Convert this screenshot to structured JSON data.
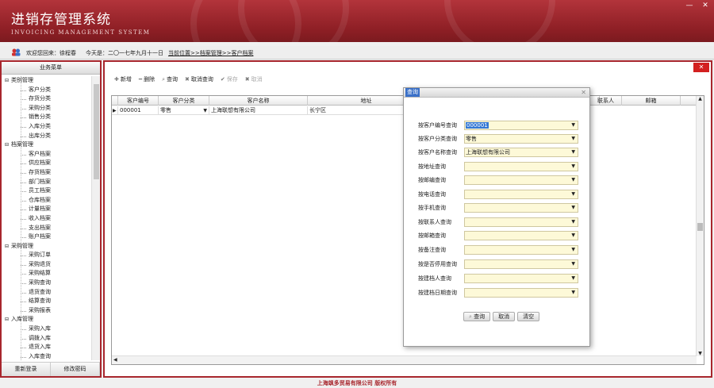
{
  "app": {
    "title": "进销存管理系统",
    "subtitle": "INVOICING MANAGEMENT SYSTEM"
  },
  "window_controls": {
    "minimize": "—",
    "close": "✕"
  },
  "infobar": {
    "welcome": "欢迎您回来：徐程春",
    "date": "今天是：二〇一七年九月十一日",
    "location": "当前位置>>档案管理>>客户档案"
  },
  "sidebar": {
    "header": "业务菜单",
    "groups": [
      {
        "label": "类别管理",
        "items": [
          "客户分类",
          "存货分类",
          "采购分类",
          "销售分类",
          "入库分类",
          "出库分类"
        ]
      },
      {
        "label": "档案管理",
        "items": [
          "客户档案",
          "供应档案",
          "存货档案",
          "部门档案",
          "员工档案",
          "仓库档案",
          "计量档案",
          "收入档案",
          "支出档案",
          "账户档案"
        ]
      },
      {
        "label": "采购管理",
        "items": [
          "采购订单",
          "采购退货",
          "采购结算",
          "采购查询",
          "退货查询",
          "结算查询",
          "采购报表"
        ]
      },
      {
        "label": "入库管理",
        "items": [
          "采购入库",
          "调拨入库",
          "退货入库",
          "入库查询"
        ]
      }
    ],
    "footer": {
      "relogin": "重新登录",
      "change_password": "修改密码"
    }
  },
  "toolbar": {
    "add": "新增",
    "delete": "删除",
    "query": "查询",
    "cancel_query": "取消查询",
    "save": "保存",
    "cancel": "取消"
  },
  "grid": {
    "columns": [
      "客户编号",
      "客户分类",
      "客户名称",
      "地址",
      "联系人",
      "邮箱"
    ],
    "rows": [
      {
        "code": "000001",
        "category": "零售",
        "name": "上海联想有限公司",
        "address": "长宁区"
      }
    ]
  },
  "dialog": {
    "title": "查询",
    "close": "✕",
    "fields": [
      {
        "label": "按客户编号查询",
        "value": "000001"
      },
      {
        "label": "按客户分类查询",
        "value": "零售"
      },
      {
        "label": "按客户名称查询",
        "value": "上海联想有限公司"
      },
      {
        "label": "按地址查询",
        "value": ""
      },
      {
        "label": "按邮编查询",
        "value": ""
      },
      {
        "label": "按电话查询",
        "value": ""
      },
      {
        "label": "按手机查询",
        "value": ""
      },
      {
        "label": "按联系人查询",
        "value": ""
      },
      {
        "label": "按邮箱查询",
        "value": ""
      },
      {
        "label": "按备注查询",
        "value": ""
      },
      {
        "label": "按是否停用查询",
        "value": ""
      },
      {
        "label": "按建档人查询",
        "value": ""
      },
      {
        "label": "按建档日期查询",
        "value": ""
      }
    ],
    "buttons": {
      "query": "查询",
      "cancel": "取消",
      "clear": "清空"
    }
  },
  "footer": {
    "copyright": "上海飒多贸易有限公司    版权所有"
  },
  "colors": {
    "brand": "#a8262d",
    "selection": "#3478d4",
    "field_bg": "#fdf9d8"
  }
}
